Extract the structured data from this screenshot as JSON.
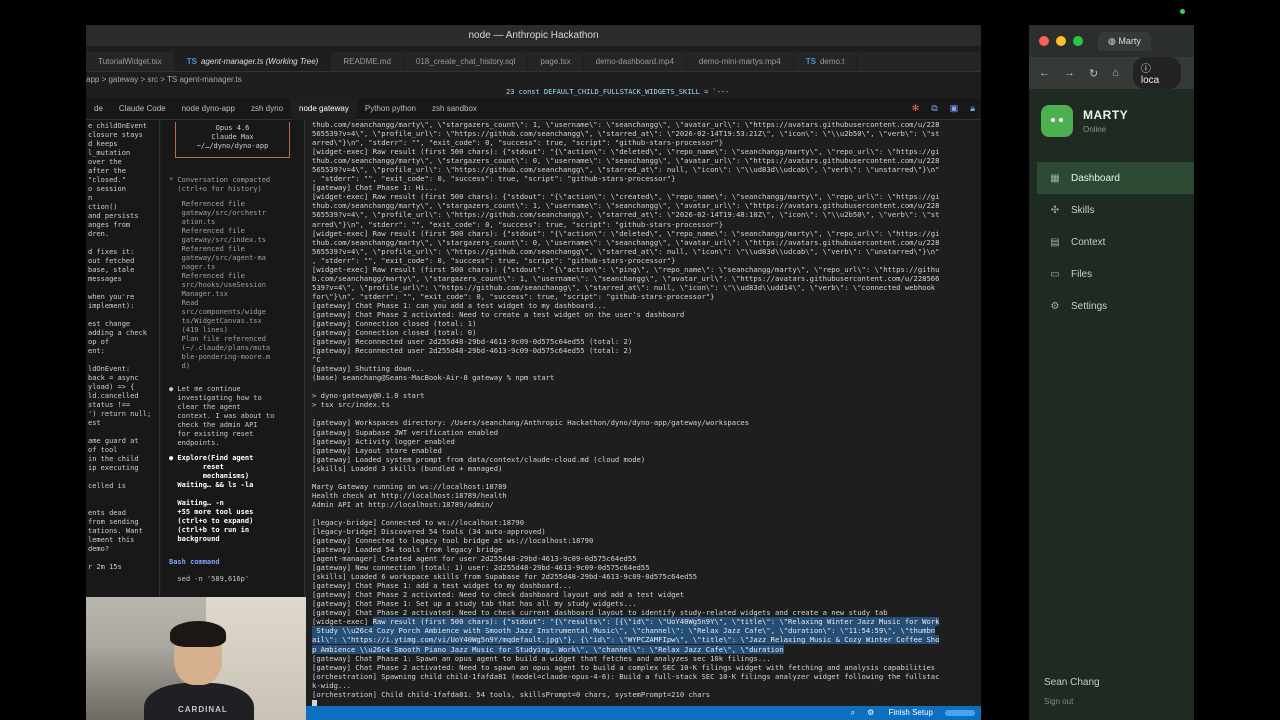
{
  "window": {
    "title": "node — Anthropic Hackathon"
  },
  "file_tabs": [
    {
      "label": "TutorialWidget.tsx",
      "prefix": "",
      "active": false
    },
    {
      "label": "agent-manager.ts (Working Tree)",
      "prefix": "TS",
      "active": true
    },
    {
      "label": "README.md",
      "prefix": "",
      "active": false
    },
    {
      "label": "018_create_chat_history.sql",
      "prefix": "",
      "active": false
    },
    {
      "label": "page.tsx",
      "prefix": "",
      "active": false
    },
    {
      "label": "demo-dashboard.mp4",
      "prefix": "",
      "active": false
    },
    {
      "label": "demo-mini-martys.mp4",
      "prefix": "",
      "active": false
    },
    {
      "label": "demo.t",
      "prefix": "TS",
      "active": false
    }
  ],
  "breadcrumb": "app > gateway > src > TS agent-manager.ts",
  "code_line": "23   const DEFAULT_CHILD_FULLSTACK_WIDGETS_SKILL = `---",
  "panel_tabs": [
    {
      "label": "de",
      "active": false
    },
    {
      "label": "Claude Code",
      "active": false
    },
    {
      "label": "node  dyno-app",
      "active": false
    },
    {
      "label": "zsh  dyno",
      "active": false
    },
    {
      "label": "node  gateway",
      "active": true
    },
    {
      "label": "Python  python",
      "active": false
    },
    {
      "label": "zsh  sandbox",
      "active": false
    }
  ],
  "left_pane_lines": [
    "e childOnEvent",
    " closure stays",
    "d keeps",
    "l_mutation",
    "over the",
    " after the",
    "\"closed.\"",
    "o session",
    "n",
    "ction()",
    "and persists",
    "anges from",
    "dren.",
    "",
    "d fixes it:",
    "out fetched",
    "base, stale",
    " messages",
    "",
    "when you're",
    "implement):",
    "",
    "est change",
    "adding a check",
    "op of",
    "ent:",
    "",
    "ldOnEvent:",
    "back = async",
    "yload) => {",
    "ld.cancelled",
    "status !==",
    "') return null;",
    "est",
    "",
    "ame guard at",
    "of tool",
    " in the child",
    "ip executing",
    "",
    "celled is",
    "",
    "",
    "ents dead",
    "from sending",
    "tations. Want",
    "lement this",
    " demo?",
    "",
    "r 2m 15s"
  ],
  "claude_pane": {
    "box_lines": [
      "Opus 4.6",
      "Claude Max",
      "~/…/dyno/dyno-app"
    ],
    "compacted": "* Conversation compacted\n  (ctrl+o for history)",
    "refs": "   Referenced file\n   gateway/src/orchestr\n   ation.ts\n   Referenced file\n   gateway/src/index.ts\n   Referenced file\n   gateway/src/agent-ma\n   nager.ts\n   Referenced file\n   src/hooks/useSession\n   Manager.tsx\n   Read\n   src/components/widge\n   ts/WidgetCanvas.tsx\n   (419 lines)\n   Plan file referenced\n   (~/.claude/plans/muta\n   ble-pondering-moore.m\n   d)",
    "continue": "● Let me continue\n  investigating how to\n  clear the agent\n  context. I was about to\n  check the admin API\n  for existing reset\n  endpoints.",
    "explore": "● Explore(Find agent\n        reset\n        mechanisms)\n  Waiting… && ls -la\n\n  Waiting… -n\n  +55 more tool uses\n  (ctrl+o to expand)\n  (ctrl+b to run in\n  background",
    "bash_header": "Bash command",
    "bash_cmd": "  sed -n '589,616p'"
  },
  "terminal_lines": [
    "thub.com/seanchangg/marty\\\", \\\"stargazers_count\\\": 1, \\\"username\\\": \\\"seanchangg\\\", \\\"avatar_url\\\": \\\"https://avatars.githubusercontent.com/u/228",
    "565539?v=4\\\", \\\"profile_url\\\": \\\"https://github.com/seanchangg\\\", \\\"starred_at\\\": \\\"2026-02-14T19:53:21Z\\\", \\\"icon\\\": \\\"\\\\u2b50\\\", \\\"verb\\\": \\\"st",
    "arred\\\"}\\n\", \"stderr\": \"\", \"exit_code\": 0, \"success\": true, \"script\": \"github-stars-processor\"}",
    "[widget-exec] Raw result (first 500 chars): {\"stdout\": \"{\\\"action\\\": \\\"deleted\\\", \\\"repo_name\\\": \\\"seanchangg/marty\\\", \\\"repo_url\\\": \\\"https://gi",
    "thub.com/seanchangg/marty\\\", \\\"stargazers_count\\\": 0, \\\"username\\\": \\\"seanchangg\\\", \\\"avatar_url\\\": \\\"https://avatars.githubusercontent.com/u/228",
    "565539?v=4\\\", \\\"profile_url\\\": \\\"https://github.com/seanchangg\\\", \\\"starred_at\\\": null, \\\"icon\\\": \\\"\\\\ud83d\\\\udcab\\\", \\\"verb\\\": \\\"unstarred\\\"}\\n\"",
    ", \"stderr\": \"\", \"exit_code\": 0, \"success\": true, \"script\": \"github-stars-processor\"}",
    "[gateway] Chat Phase 1: Hi...",
    "[widget-exec] Raw result (first 500 chars): {\"stdout\": \"{\\\"action\\\": \\\"created\\\", \\\"repo_name\\\": \\\"seanchangg/marty\\\", \\\"repo_url\\\": \\\"https://gi",
    "thub.com/seanchangg/marty\\\", \\\"stargazers_count\\\": 1, \\\"username\\\": \\\"seanchangg\\\", \\\"avatar_url\\\": \\\"https://avatars.githubusercontent.com/u/228",
    "565539?v=4\\\", \\\"profile_url\\\": \\\"https://github.com/seanchangg\\\", \\\"starred_at\\\": \\\"2026-02-14T19:48:10Z\\\", \\\"icon\\\": \\\"\\\\u2b50\\\", \\\"verb\\\": \\\"st",
    "arred\\\"}\\n\", \"stderr\": \"\", \"exit_code\": 0, \"success\": true, \"script\": \"github-stars-processor\"}",
    "[widget-exec] Raw result (first 500 chars): {\"stdout\": \"{\\\"action\\\": \\\"deleted\\\", \\\"repo_name\\\": \\\"seanchangg/marty\\\", \\\"repo_url\\\": \\\"https://gi",
    "thub.com/seanchangg/marty\\\", \\\"stargazers_count\\\": 0, \\\"username\\\": \\\"seanchangg\\\", \\\"avatar_url\\\": \\\"https://avatars.githubusercontent.com/u/228",
    "565539?v=4\\\", \\\"profile_url\\\": \\\"https://github.com/seanchangg\\\", \\\"starred_at\\\": null, \\\"icon\\\": \\\"\\\\ud83d\\\\udcab\\\", \\\"verb\\\": \\\"unstarred\\\"}\\n\"",
    ", \"stderr\": \"\", \"exit_code\": 0, \"success\": true, \"script\": \"github-stars-processor\"}",
    "[widget-exec] Raw result (first 500 chars): {\"stdout\": \"{\\\"action\\\": \\\"ping\\\", \\\"repo_name\\\": \\\"seanchangg/marty\\\", \\\"repo_url\\\": \\\"https://githu",
    "b.com/seanchangg/marty\\\", \\\"stargazers_count\\\": 1, \\\"username\\\": \\\"seanchangg\\\", \\\"avatar_url\\\": \\\"https://avatars.githubusercontent.com/u/228566",
    "539?v=4\\\", \\\"profile_url\\\": \\\"https://github.com/seanchangg\\\", \\\"starred_at\\\": null, \\\"icon\\\": \\\"\\\\ud83d\\\\udd14\\\", \\\"verb\\\": \\\"connected webhook",
    "for\\\"}\\n\", \"stderr\": \"\", \"exit_code\": 0, \"success\": true, \"script\": \"github-stars-processor\"}",
    "[gateway] Chat Phase 1: can you add a test widget to my dashboard...",
    "[gateway] Chat Phase 2 activated: Need to create a test widget on the user's dashboard",
    "[gateway] Connection closed (total: 1)",
    "[gateway] Connection closed (total: 0)",
    "[gateway] Reconnected user 2d255d48-29bd-4613-9c09-0d575c64ed55 (total: 2)",
    "[gateway] Reconnected user 2d255d48-29bd-4613-9c09-0d575c64ed55 (total: 2)",
    "^C",
    "[gateway] Shutting down...",
    "(base) seanchang@Seans-MacBook-Air-8 gateway % npm start",
    "",
    "> dyno-gateway@0.1.0 start",
    "> tsx src/index.ts",
    "",
    "[gateway] Workspaces directory: /Users/seanchang/Anthropic Hackathon/dyno/dyno-app/gateway/workspaces",
    "[gateway] Supabase JWT verification enabled",
    "[gateway] Activity logger enabled",
    "[gateway] Layout store enabled",
    "[gateway] Loaded system prompt from data/context/claude-cloud.md (cloud mode)",
    "[skills] Loaded 3 skills (bundled + managed)",
    "",
    "Marty Gateway running on ws://localhost:18789",
    "Health check at http://localhost:18789/health",
    "Admin API at http://localhost:18789/admin/",
    "",
    "[legacy-bridge] Connected to ws://localhost:18790",
    "[legacy-bridge] Discovered 54 tools (34 auto-approved)",
    "[gateway] Connected to legacy tool bridge at ws://localhost:18790",
    "[gateway] Loaded 54 tools from legacy bridge",
    "[agent-manager] Created agent for user 2d255d48-29bd-4613-9c09-0d575c64ed55",
    "[gateway] New connection (total: 1) user: 2d255d48-29bd-4613-9c09-0d575c64ed55",
    "[skills] Loaded 6 workspace skills from Supabase for 2d255d48-29bd-4613-9c09-0d575c64ed55",
    "[gateway] Chat Phase 1: add a test widget to my dashboard...",
    "[gateway] Chat Phase 2 activated: Need to check dashboard layout and add a test widget",
    "[gateway] Chat Phase 1: Set up a study tab that has all my study widgets...",
    "[gateway] Chat Phase 2 activated: Need to check current dashboard layout to identify study-related widgets and create a new study tab"
  ],
  "terminal_highlight": [
    {
      "pre": "[widget-exec] ",
      "hl": "Raw result (first 500 chars): {\"stdout\": \"{\\\"results\\\": [{\\\"id\\\": \\\"UoY40Wg5n9Y\\\", \\\"title\\\": \\\"Relaxing Winter Jazz Music for Work"
    },
    {
      "pre": "",
      "hl": " Study \\\\u26c4 Cozy Porch Ambience with Smooth Jazz Instrumental Music\\\", \\\"channel\\\": \\\"Relax Jazz Cafe\\\", \\\"duration\\\": \\\"11:54:59\\\", \\\"thumbn"
    },
    {
      "pre": "",
      "hl": "ail\\\": \\\"https://i.ytimg.com/vi/UoY40Wg5n9Y/mqdefault.jpg\\\"}, {\\\"id\\\": \\\"WYPCZAMFIpw\\\", \\\"title\\\": \\\"Jazz Relaxing Music & Cozy Winter Coffee Sho"
    },
    {
      "pre": "",
      "hl": "p Ambience \\\\u26c4 Smooth Piano Jazz Music for Studying, Work\\\", \\\"channel\\\": \\\"Relax Jazz Cafe\\\", \\\"duration"
    }
  ],
  "terminal_tail": [
    "[gateway] Chat Phase 1: Spawn an opus agent to build a widget that fetches and analyzes sec 10k filings...",
    "[gateway] Chat Phase 2 activated: Need to spawn an opus agent to build a complex SEC 10-K filings widget with fetching and analysis capabilities",
    "[orchestration] Spawning child child-1fafda81 (model=claude-opus-4-6): Build a full-stack SEC 10-K filings analyzer widget following the fullstac",
    "k-widg...",
    "[orchestration] Child child-1fafda81: 54 tools, skillsPrompt=0 chars, systemPrompt=210 chars"
  ],
  "status_bar": {
    "finish_setup": "Finish Setup"
  },
  "browser": {
    "tab_title": "Marty",
    "url": "loca",
    "brand_name": "MARTY",
    "brand_status": "Online",
    "nav": [
      {
        "label": "Dashboard",
        "icon": "grid-icon",
        "active": true
      },
      {
        "label": "Skills",
        "icon": "puzzle-icon",
        "active": false
      },
      {
        "label": "Context",
        "icon": "document-icon",
        "active": false
      },
      {
        "label": "Files",
        "icon": "folder-icon",
        "active": false
      },
      {
        "label": "Settings",
        "icon": "gear-icon",
        "active": false
      }
    ],
    "user_name": "Sean Chang",
    "sign_out": "Sign out",
    "accent": "#4caf50"
  },
  "webcam": {
    "shirt_text": "CARDINAL"
  }
}
